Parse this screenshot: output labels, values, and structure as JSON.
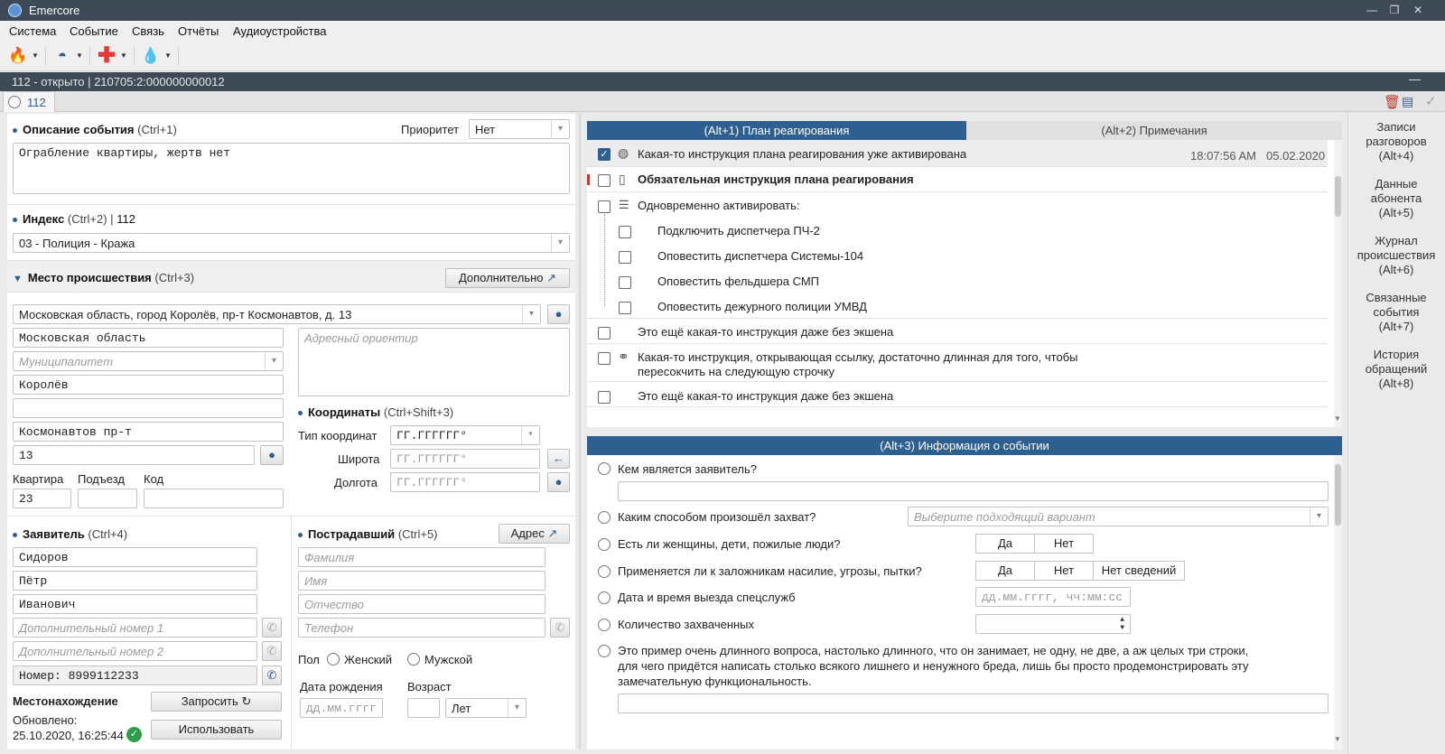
{
  "app": {
    "title": "Emercore",
    "window_controls": [
      "min",
      "restore",
      "close"
    ]
  },
  "menu": [
    "Система",
    "Событие",
    "Связь",
    "Отчёты",
    "Аудиоустройства"
  ],
  "toolbar": [
    {
      "icon": "fire-icon",
      "color": "#e8452b"
    },
    {
      "icon": "police-icon",
      "color": "#2d5f8f"
    },
    {
      "icon": "medical-cross-icon",
      "color": "#e53935"
    },
    {
      "icon": "gas-flame-icon",
      "color": "#1e63c8"
    }
  ],
  "infobar": {
    "text": "112 - открыто | 210705:2:000000000012"
  },
  "event_tab": {
    "label": "112"
  },
  "desc": {
    "title": "Описание события",
    "hotkey": "(Ctrl+1)",
    "priority_label": "Приоритет",
    "priority_value": "Нет",
    "text": "Ограбление квартиры, жертв нет"
  },
  "index": {
    "title": "Индекс",
    "hotkey": "(Ctrl+2) |",
    "number": "112",
    "value": "03 - Полиция - Кража"
  },
  "place": {
    "title": "Место происшествия",
    "hotkey": "(Ctrl+3)",
    "more_button": "Дополнительно",
    "address": "Московская область, город Королёв, пр-т Космонавтов, д. 13",
    "region": "Московская область",
    "municipality_placeholder": "Муниципалитет",
    "city": "Королёв",
    "district": "",
    "street": "Космонавтов пр-т",
    "house": "13",
    "apt_label": "Квартира",
    "entrance_label": "Подъезд",
    "code_label": "Код",
    "apt": "23",
    "entrance": "",
    "code": "",
    "landmark_placeholder": "Адресный ориентир",
    "coords_title": "Координаты",
    "coords_hotkey": "(Ctrl+Shift+3)",
    "coord_type_label": "Тип координат",
    "coord_type": "ГГ.ГГГГГГ°",
    "lat_label": "Широта",
    "lon_label": "Долгота",
    "lat_placeholder": "ГГ.ГГГГГГ°",
    "lon_placeholder": "ГГ.ГГГГГГ°"
  },
  "caller": {
    "title": "Заявитель",
    "hotkey": "(Ctrl+4)",
    "last": "Сидоров",
    "first": "Пётр",
    "middle": "Иванович",
    "phone1_placeholder": "Дополнительный номер 1",
    "phone2_placeholder": "Дополнительный номер 2",
    "number": "Номер: 8999112233",
    "location_label": "Местонахождение",
    "updated_label": "Обновлено:",
    "updated_value": "25.10.2020, 16:25:44",
    "request_button": "Запросить",
    "use_button": "Использовать"
  },
  "victim": {
    "title": "Пострадавший",
    "hotkey": "(Ctrl+5)",
    "address_button": "Адрес",
    "last_placeholder": "Фамилия",
    "first_placeholder": "Имя",
    "middle_placeholder": "Отчество",
    "phone_placeholder": "Телефон",
    "gender_label": "Пол",
    "female": "Женский",
    "male": "Мужской",
    "dob_label": "Дата рождения",
    "dob_placeholder": "дд.мм.гггг",
    "age_label": "Возраст",
    "age_unit": "Лет"
  },
  "plan": {
    "tab_active": "(Alt+1) План реагирования",
    "tab_other": "(Alt+2) Примечания",
    "items": [
      {
        "text": "Какая-то инструкция плана реагирования уже активирована",
        "checked": true,
        "icon": "globe-icon",
        "time": "18:07:56 AM",
        "date": "05.02.2020"
      },
      {
        "text": "Обязательная инструкция плана реагирования",
        "checked": false,
        "icon": "document-icon",
        "bold": true
      },
      {
        "text": "Одновременно активировать:",
        "checked": false,
        "icon": "list-icon"
      },
      {
        "text": "Подключить диспетчера ПЧ-2",
        "checked": false,
        "sub": true
      },
      {
        "text": "Оповестить диспетчера Системы-104",
        "checked": false,
        "sub": true
      },
      {
        "text": "Оповестить фельдшера СМП",
        "checked": false,
        "sub": true
      },
      {
        "text": "Оповестить дежурного полиции УМВД",
        "checked": false,
        "sub": true
      },
      {
        "text": "Это ещё какая-то инструкция даже без экшена",
        "checked": false
      },
      {
        "text": "Какая-то инструкция, открывающая ссылку, достаточно длинная для того, чтобы",
        "text2": "пересокчить на следующую строчку",
        "checked": false,
        "icon": "link-icon"
      },
      {
        "text": "Это ещё какая-то инструкция даже без экшена",
        "checked": false
      }
    ]
  },
  "info": {
    "title": "(Alt+3) Информация о событии",
    "q1": "Кем является заявитель?",
    "q2": "Каким способом произошёл захват?",
    "q2_placeholder": "Выберите подходящий вариант",
    "q3": "Есть ли женщины, дети, пожилые люди?",
    "q4": "Применяется ли к заложникам насилие, угрозы, пытки?",
    "q5": "Дата и время выезда спецслужб",
    "q5_placeholder": "дд.мм.гггг, чч:мм:сс",
    "q6": "Количество захваченных",
    "q7_l1": "Это пример очень длинного вопроса, настолько длинного, что он занимает, не одну, не две, а аж целых три строки,",
    "q7_l2": "для чего придётся написать столько всякого лишнего и ненужного бреда, лишь бы просто продемонстрировать эту",
    "q7_l3": "замечательную функциональность.",
    "yes": "Да",
    "no": "Нет",
    "no_info": "Нет сведений"
  },
  "sidebar": [
    {
      "l1": "Записи",
      "l2": "разговоров",
      "l3": "(Alt+4)"
    },
    {
      "l1": "Данные",
      "l2": "абонента",
      "l3": "(Alt+5)"
    },
    {
      "l1": "Журнал",
      "l2": "происшествия",
      "l3": "(Alt+6)"
    },
    {
      "l1": "Связанные",
      "l2": "события",
      "l3": "(Alt+7)"
    },
    {
      "l1": "История",
      "l2": "обращений",
      "l3": "(Alt+8)"
    }
  ],
  "colors": {
    "accent": "#2d5f8f",
    "titlebar": "#3e4a57",
    "required": "#c0392b",
    "success": "#2e9e4b"
  }
}
